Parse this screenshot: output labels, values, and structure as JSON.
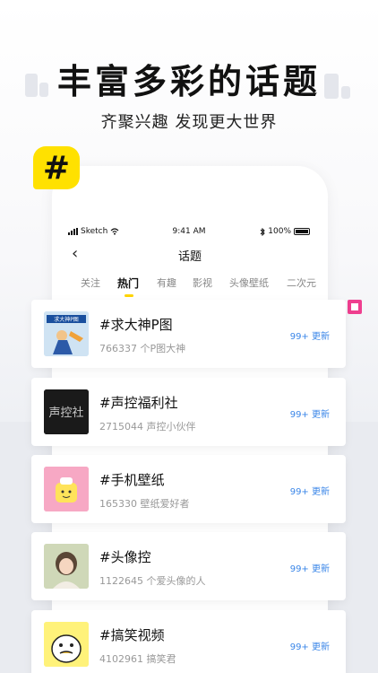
{
  "headline": "丰富多彩的话题",
  "subline": "齐聚兴趣 发现更大世界",
  "badge_symbol": "#",
  "status_bar": {
    "carrier": "Sketch",
    "time": "9:41 AM",
    "battery": "100%"
  },
  "nav": {
    "back_glyph": "‹",
    "title": "话题"
  },
  "tabs": [
    {
      "label": "关注",
      "active": false
    },
    {
      "label": "热门",
      "active": true
    },
    {
      "label": "有趣",
      "active": false
    },
    {
      "label": "影视",
      "active": false
    },
    {
      "label": "头像壁纸",
      "active": false
    },
    {
      "label": "二次元",
      "active": false
    }
  ],
  "topics": [
    {
      "title": "#求大神P图",
      "subtitle": "766337 个P图大神",
      "badge": "99+ 更新",
      "thumb_text": "求大神P图",
      "thumb_bg": "#cfe3f3",
      "thumb_color": "#1a4f9e"
    },
    {
      "title": "#声控福利社",
      "subtitle": "2715044 声控小伙伴",
      "badge": "99+ 更新",
      "thumb_text": "声控社",
      "thumb_bg": "#1a1a1a",
      "thumb_color": "#cccccc"
    },
    {
      "title": "#手机壁纸",
      "subtitle": "165330 壁纸爱好者",
      "badge": "99+ 更新",
      "thumb_text": "",
      "thumb_bg": "#f7a8c4",
      "thumb_color": "#ffe35a"
    },
    {
      "title": "#头像控",
      "subtitle": "1122645 个爱头像的人",
      "badge": "99+ 更新",
      "thumb_text": "",
      "thumb_bg": "#d8dfc4",
      "thumb_color": "#7a6a50"
    },
    {
      "title": "#搞笑视频",
      "subtitle": "4102961 搞笑君",
      "badge": "99+ 更新",
      "thumb_text": "",
      "thumb_bg": "#fff27a",
      "thumb_color": "#222222"
    }
  ],
  "colors": {
    "accent_yellow": "#ffe100",
    "link_blue": "#3a86e8",
    "marker_pink": "#ef3f8f"
  },
  "icons": [
    "hashtag-icon",
    "signal-icon",
    "wifi-icon",
    "bluetooth-icon",
    "battery-icon",
    "back-arrow-icon"
  ]
}
